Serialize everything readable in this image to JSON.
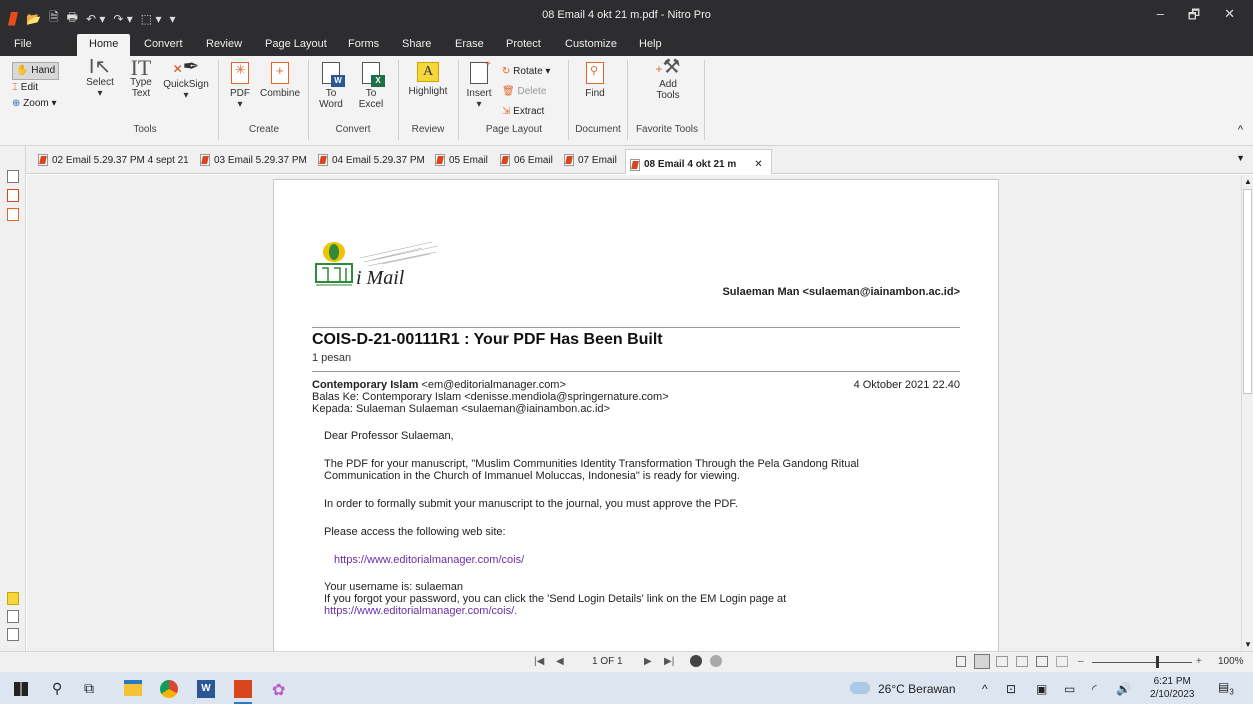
{
  "window": {
    "title": "08 Email 4 okt 21 m.pdf - Nitro Pro",
    "controls": [
      "–",
      "🗗",
      "✕"
    ]
  },
  "quick_access": [
    "📂",
    "🗎",
    "🖶",
    "↶ ▾",
    "↷ ▾",
    "⬚ ▾",
    "▾"
  ],
  "menu": {
    "tabs": [
      "File",
      "Home",
      "Convert",
      "Review",
      "Page Layout",
      "Forms",
      "Share",
      "Erase",
      "Protect",
      "Customize",
      "Help"
    ],
    "active": "Home"
  },
  "ribbon": {
    "tools": {
      "hand": "Hand",
      "edit": "Edit",
      "zoom": "Zoom ▾",
      "select": "Select",
      "type_text_1": "Type",
      "type_text_2": "Text",
      "quicksign": "QuickSign",
      "label": "Tools"
    },
    "create": {
      "pdf": "PDF",
      "combine": "Combine",
      "label": "Create"
    },
    "convert": {
      "to_word_1": "To",
      "to_word_2": "Word",
      "to_excel_1": "To",
      "to_excel_2": "Excel",
      "label": "Convert"
    },
    "review": {
      "highlight": "Highlight",
      "label": "Review"
    },
    "page_layout": {
      "insert": "Insert",
      "rotate": "Rotate ▾",
      "delete": "Delete",
      "extract": "Extract",
      "label": "Page Layout"
    },
    "document": {
      "find": "Find",
      "label": "Document"
    },
    "favorite": {
      "add_1": "Add",
      "add_2": "Tools",
      "label": "Favorite Tools"
    },
    "collapse": "^"
  },
  "doc_tabs": [
    "02 Email 5.29.37 PM 4 sept 21",
    "03 Email 5.29.37 PM",
    "04 Email 5.29.37 PM",
    "05 Email",
    "06 Email",
    "07 Email",
    "08 Email 4 okt 21 m"
  ],
  "doc_tab_close": "✕",
  "email": {
    "logo_text": "i Mail",
    "sender_header": "Sulaeman Man <sulaeman@iainambon.ac.id>",
    "subject": "COIS-D-21-00111R1 : Your PDF Has Been Built",
    "count": "1 pesan",
    "from_name": "Contemporary Islam",
    "from_addr": " <em@editorialmanager.com>",
    "date": "4 Oktober 2021 22.40",
    "reply_to": "Balas Ke: Contemporary Islam <denisse.mendiola@springernature.com>",
    "to": "Kepada: Sulaeman Sulaeman <sulaeman@iainambon.ac.id>",
    "greeting": "Dear Professor Sulaeman,",
    "p1_line1": "The PDF for your manuscript, \"Muslim Communities Identity Transformation Through the Pela Gandong Ritual",
    "p1_line2": "Communication in the Church of Immanuel Moluccas, Indonesia\" is ready for viewing.",
    "p2": "In order to formally submit your manuscript to the journal, you must approve the PDF.",
    "p3": "Please access the following web site:",
    "url1": "https://www.editorialmanager.com/cois/",
    "p4": "Your username is: sulaeman",
    "p5": "If you forgot your password, you can click the 'Send Login Details' link on the EM Login page at",
    "url2": "https://www.editorialmanager.com/cois/."
  },
  "statusbar": {
    "nav_first": "|◀",
    "nav_prev": "◀",
    "page": "1 OF 1",
    "nav_next": "▶",
    "nav_last": "▶|",
    "zoom_minus": "–",
    "zoom_plus": "+",
    "zoom": "100%"
  },
  "taskbar": {
    "weather": "26°C  Berawan",
    "time": "6:21 PM",
    "date": "2/10/2023",
    "notif_count": "3"
  }
}
